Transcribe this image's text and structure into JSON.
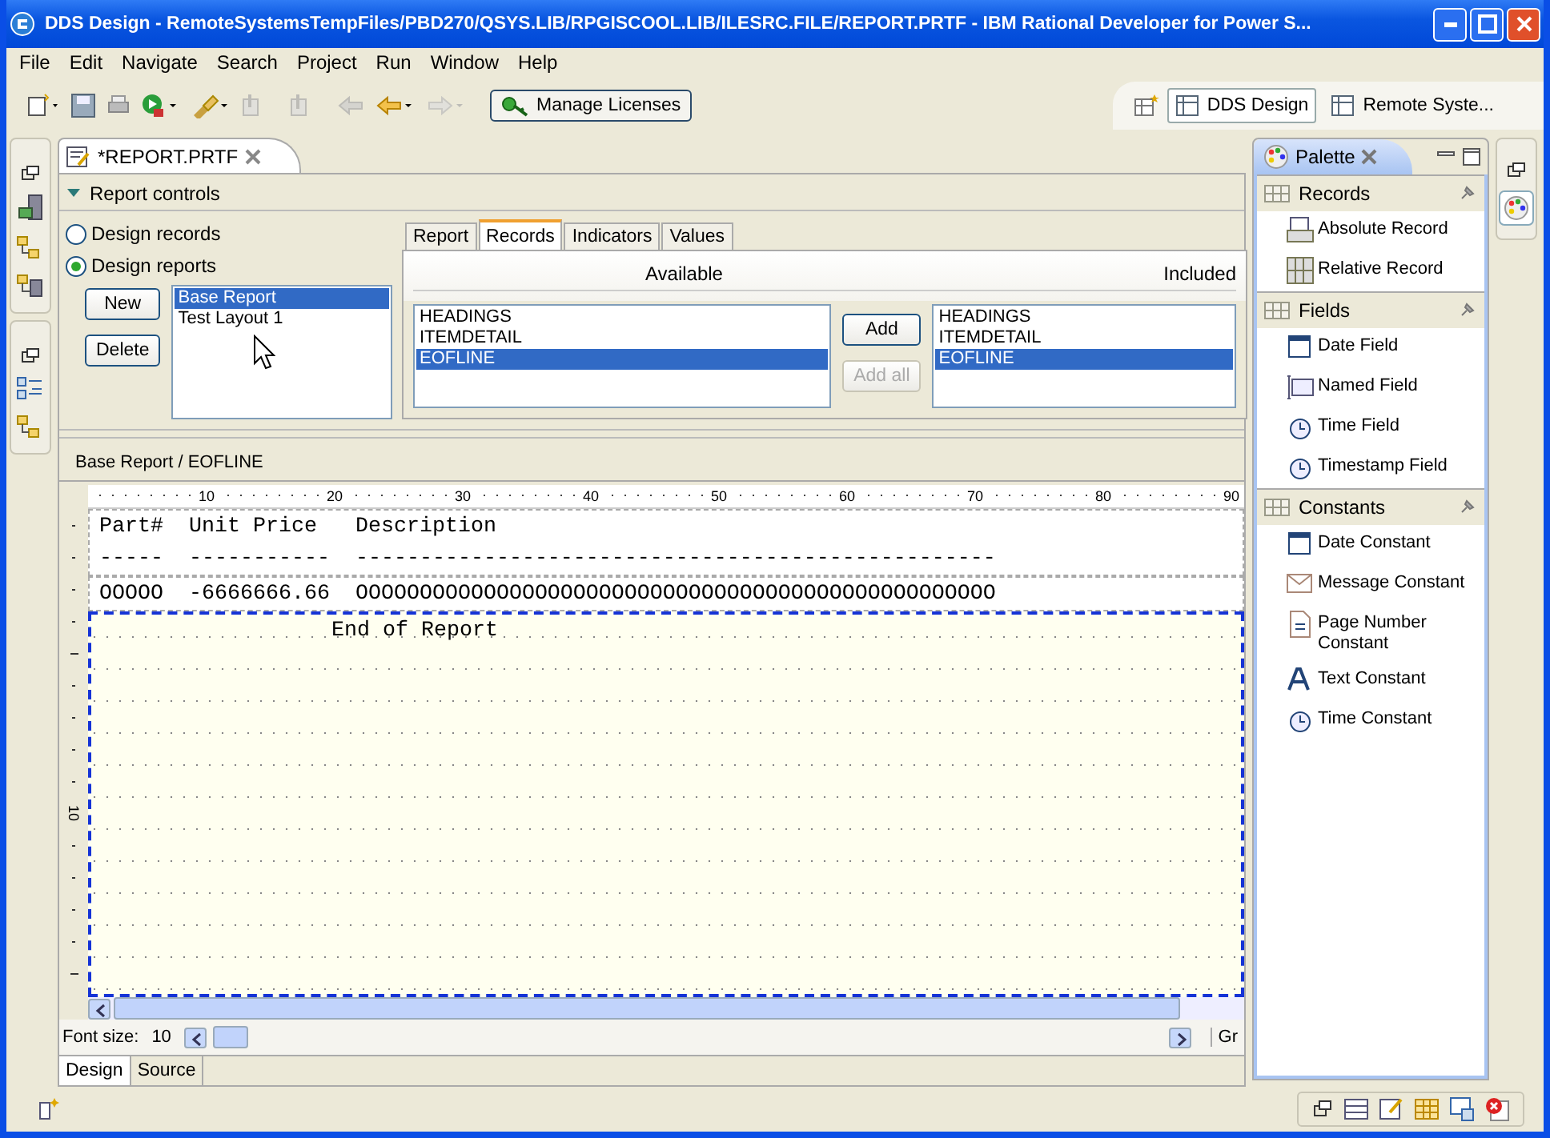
{
  "window": {
    "title": "DDS Design - RemoteSystemsTempFiles/PBD270/QSYS.LIB/RPGISCOOL.LIB/ILESRC.FILE/REPORT.PRTF - IBM Rational Developer for Power S..."
  },
  "menu": [
    "File",
    "Edit",
    "Navigate",
    "Search",
    "Project",
    "Run",
    "Window",
    "Help"
  ],
  "toolbar": {
    "license_button": "Manage Licenses"
  },
  "perspectives": [
    {
      "label": "DDS Design",
      "selected": true
    },
    {
      "label": "Remote Syste...",
      "selected": false
    }
  ],
  "editor_tab": {
    "title": "*REPORT.PRTF"
  },
  "report_controls": {
    "title": "Report controls",
    "expanded": true,
    "modes": [
      {
        "label": "Design records",
        "selected": false
      },
      {
        "label": "Design reports",
        "selected": true
      }
    ],
    "buttons": [
      "New",
      "Delete"
    ],
    "reports": [
      {
        "label": "Base Report",
        "selected": true
      },
      {
        "label": "Test Layout 1",
        "selected": false
      }
    ],
    "tabs": [
      {
        "label": "Report",
        "selected": false
      },
      {
        "label": "Records",
        "selected": true
      },
      {
        "label": "Indicators",
        "selected": false
      },
      {
        "label": "Values",
        "selected": false
      }
    ],
    "available": {
      "heading": "Available",
      "items": [
        {
          "label": "HEADINGS",
          "selected": false
        },
        {
          "label": "ITEMDETAIL",
          "selected": false
        },
        {
          "label": "EOFLINE",
          "selected": true
        }
      ]
    },
    "move_buttons": [
      {
        "label": "Add",
        "disabled": false
      },
      {
        "label": "Add all",
        "disabled": true
      }
    ],
    "included": {
      "heading": "Included",
      "items": [
        {
          "label": "HEADINGS",
          "selected": false
        },
        {
          "label": "ITEMDETAIL",
          "selected": false
        },
        {
          "label": "EOFLINE",
          "selected": true
        }
      ]
    }
  },
  "design": {
    "breadcrumb": "Base Report / EOFLINE",
    "ruler_labels": [
      "10",
      "20",
      "30",
      "40",
      "50",
      "60",
      "70",
      "80",
      "90"
    ],
    "vertical_ruler_label": "10",
    "records": [
      {
        "selected": false,
        "lines": [
          "Part#  Unit Price   Description",
          "-----  -----------  --------------------------------------------------"
        ]
      },
      {
        "selected": false,
        "lines": [
          "OOOOO  -6666666.66  OOOOOOOOOOOOOOOOOOOOOOOOOOOOOOOOOOOOOOOOOOOOOOOOOO"
        ]
      },
      {
        "selected": true,
        "lines": [
          "                  End of Report"
        ]
      }
    ],
    "font_size_label": "Font size:",
    "font_size": "10",
    "cut_label": "Gr",
    "views": [
      {
        "label": "Design",
        "selected": true
      },
      {
        "label": "Source",
        "selected": false
      }
    ]
  },
  "palette": {
    "title": "Palette",
    "groups": [
      {
        "label": "Records",
        "items": [
          "Absolute Record",
          "Relative Record"
        ]
      },
      {
        "label": "Fields",
        "items": [
          "Date Field",
          "Named Field",
          "Time Field",
          "Timestamp Field"
        ]
      },
      {
        "label": "Constants",
        "items": [
          "Date Constant",
          "Message Constant",
          "Page Number Constant",
          "Text Constant",
          "Time Constant"
        ]
      }
    ]
  }
}
